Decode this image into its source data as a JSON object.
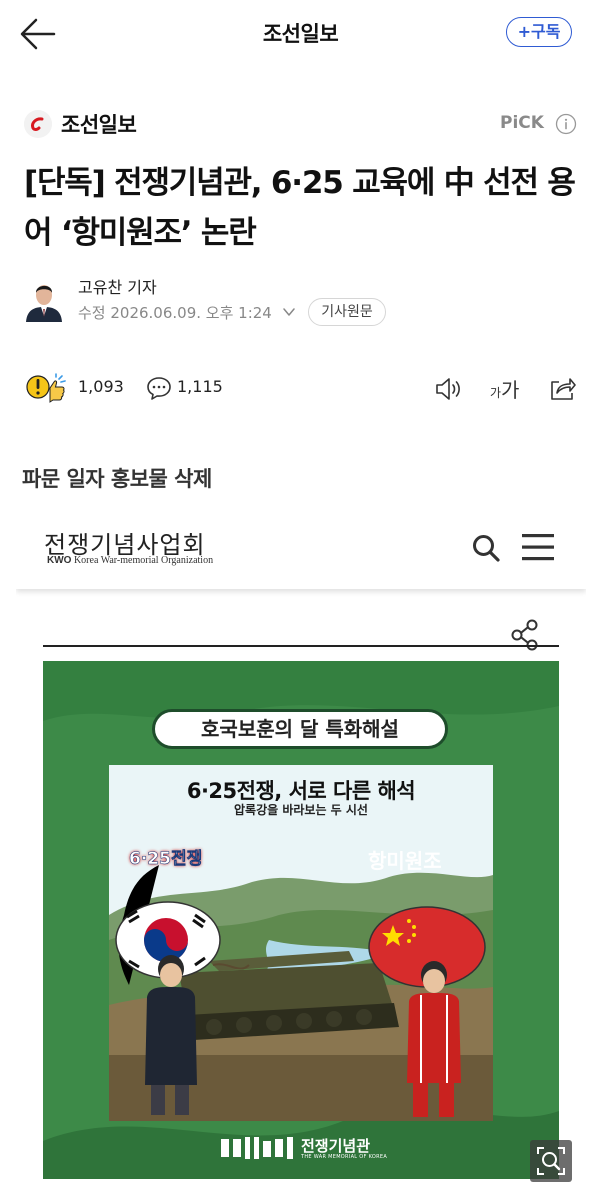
{
  "header": {
    "title": "조선일보",
    "subscribe_label": "+구독"
  },
  "press": {
    "name": "조선일보",
    "pick_label": "PiCK",
    "brand_color": "#d71920"
  },
  "article": {
    "headline": "[단독] 전쟁기념관, 6·25 교육에 中 선전 용어 ‘항미원조’ 논란",
    "reporter": "고유찬 기자",
    "date": "수정 2026.06.09. 오후 1:24",
    "original_label": "기사원문",
    "reaction_count": "1,093",
    "comment_count": "1,115",
    "font_small": "가",
    "font_big": "가",
    "image_caption": "파문 일자 홍보물 삭제"
  },
  "embedded": {
    "site_title": "전쟁기념사업회",
    "site_sub_bold": "KWO",
    "site_sub": " Korea War-memorial Organization",
    "poster": {
      "label": "호국보훈의 달 특화해설",
      "title": "6·25전쟁, 서로 다른 해석",
      "subtitle": "압록강을 바라보는 두 시선",
      "left_bubble": "6·25전쟁",
      "right_bubble": "항미원조",
      "footer": "전쟁기념관",
      "footer_sub": "THE WAR MEMORIAL OF KOREA"
    }
  },
  "icons": {
    "back": "arrow-left-icon",
    "info": "info-icon",
    "reaction": "reaction-icon",
    "comment": "comment-icon",
    "speaker": "speaker-icon",
    "share": "share-icon",
    "search": "search-icon",
    "menu": "hamburger-menu-icon",
    "zoom": "zoom-icon"
  },
  "colors": {
    "subscribe": "#2f5bd3",
    "poster_green": "#3d8a48"
  }
}
